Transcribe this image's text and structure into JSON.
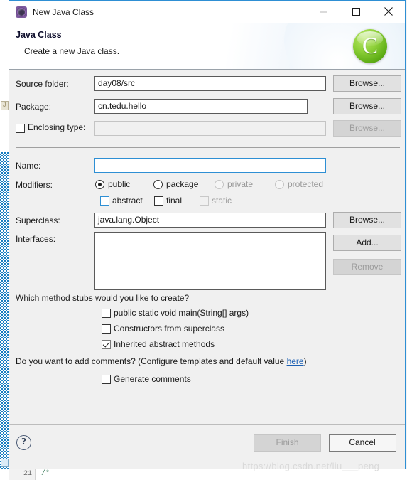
{
  "window": {
    "title": "New Java Class",
    "icon": "java-wizard-gear-icon",
    "controls": {
      "minimize": "—",
      "maximize": "☐",
      "close": "✕"
    }
  },
  "header": {
    "title": "Java Class",
    "description": "Create a new Java class.",
    "banner_letter": "C"
  },
  "form": {
    "source_folder": {
      "label": "Source folder:",
      "value": "day08/src",
      "browse_label": "Browse..."
    },
    "package": {
      "label": "Package:",
      "value": "cn.tedu.hello",
      "browse_label": "Browse..."
    },
    "enclosing_type": {
      "label": "Enclosing type:",
      "value": "",
      "checked": false,
      "browse_label": "Browse...",
      "disabled": true
    },
    "name": {
      "label": "Name:",
      "value": "",
      "focused": true
    },
    "modifiers": {
      "label": "Modifiers:",
      "radios": [
        {
          "label": "public",
          "selected": true,
          "disabled": false
        },
        {
          "label": "package",
          "selected": false,
          "disabled": false
        },
        {
          "label": "private",
          "selected": false,
          "disabled": true
        },
        {
          "label": "protected",
          "selected": false,
          "disabled": true
        }
      ],
      "checkboxes": [
        {
          "label": "abstract",
          "checked": false,
          "disabled": false,
          "style": "blue"
        },
        {
          "label": "final",
          "checked": false,
          "disabled": false,
          "style": "dark"
        },
        {
          "label": "static",
          "checked": false,
          "disabled": true,
          "style": "gray"
        }
      ]
    },
    "superclass": {
      "label": "Superclass:",
      "value": "java.lang.Object",
      "browse_label": "Browse..."
    },
    "interfaces": {
      "label": "Interfaces:",
      "items": [],
      "add_label": "Add...",
      "remove_label": "Remove",
      "remove_disabled": true
    }
  },
  "stubs": {
    "question": "Which method stubs would you like to create?",
    "options": [
      {
        "label": "public static void main(String[] args)",
        "checked": false
      },
      {
        "label": "Constructors from superclass",
        "checked": false
      },
      {
        "label": "Inherited abstract methods",
        "checked": true
      }
    ]
  },
  "comments": {
    "question_prefix": "Do you want to add comments? (Configure templates and default value ",
    "link_label": "here",
    "question_suffix": ")",
    "option": {
      "label": "Generate comments",
      "checked": false
    }
  },
  "footer": {
    "help_glyph": "?",
    "finish_label": "Finish",
    "finish_disabled": true,
    "cancel_label": "Cancel"
  },
  "watermark": "https://blog.csdn.net/liu___peng",
  "backdrop": {
    "gutter_line_number": "21",
    "code_fragment": "/*"
  },
  "colors": {
    "accent": "#2e8fd4",
    "dialog_bg": "#f0f0f0",
    "link": "#1b5fb3",
    "banner_green": "#6fbf24",
    "disabled_text": "#9a9a9a"
  }
}
